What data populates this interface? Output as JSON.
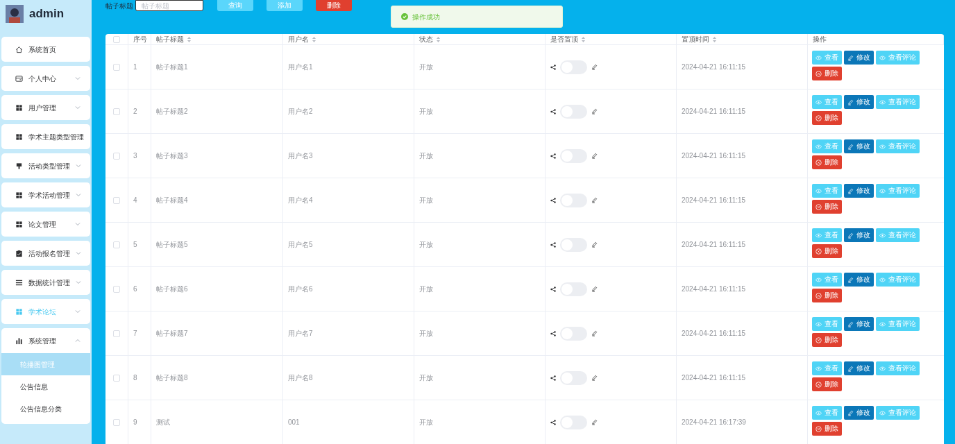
{
  "sidebar": {
    "user": "admin",
    "items": [
      {
        "label": "系统首页",
        "kind": "home",
        "expandable": false,
        "expanded": false,
        "selected": false
      },
      {
        "label": "个人中心",
        "kind": "card",
        "expandable": true,
        "expanded": false,
        "selected": false
      },
      {
        "label": "用户管理",
        "kind": "grid",
        "expandable": true,
        "expanded": false,
        "selected": false
      },
      {
        "label": "学术主题类型管理",
        "kind": "grid",
        "expandable": false,
        "expanded": false,
        "selected": false
      },
      {
        "label": "活动类型管理",
        "kind": "flag",
        "expandable": true,
        "expanded": false,
        "selected": false
      },
      {
        "label": "学术活动管理",
        "kind": "grid",
        "expandable": true,
        "expanded": false,
        "selected": false
      },
      {
        "label": "论文管理",
        "kind": "grid",
        "expandable": true,
        "expanded": false,
        "selected": false
      },
      {
        "label": "活动报名管理",
        "kind": "clipboard",
        "expandable": true,
        "expanded": false,
        "selected": false
      },
      {
        "label": "数据统计管理",
        "kind": "list",
        "expandable": true,
        "expanded": false,
        "selected": false
      },
      {
        "label": "学术论坛",
        "kind": "grid",
        "expandable": true,
        "expanded": false,
        "selected": true
      },
      {
        "label": "系统管理",
        "kind": "chart",
        "expandable": true,
        "expanded": true,
        "selected": false,
        "children": [
          {
            "label": "轮播图管理",
            "selected": true
          },
          {
            "label": "公告信息",
            "selected": false
          },
          {
            "label": "公告信息分类",
            "selected": false
          }
        ]
      }
    ]
  },
  "toolbar": {
    "label": "帖子标题",
    "search": {
      "placeholder": "帖子标题"
    },
    "buttons": [
      {
        "label": "查询",
        "kind": "light"
      },
      {
        "label": "添加",
        "kind": "light"
      },
      {
        "label": "删除",
        "kind": "danger"
      }
    ]
  },
  "toast": {
    "message": "操作成功"
  },
  "table": {
    "columns": [
      {
        "label": "序号"
      },
      {
        "label": "帖子标题",
        "sortable": true
      },
      {
        "label": "用户名",
        "sortable": true
      },
      {
        "label": "状态",
        "sortable": true
      },
      {
        "label": "是否置顶",
        "sortable": true
      },
      {
        "label": "置顶时间",
        "sortable": true
      },
      {
        "label": "操作",
        "sortable": false
      }
    ],
    "header_checked": false,
    "rows": [
      {
        "checked": false,
        "index": "1",
        "title": "帖子标题1",
        "user": "用户名1",
        "status": "开放",
        "pinned": false,
        "time": "2024-04-21 16:11:15",
        "actions": [
          {
            "label": "查看",
            "kind": "view"
          },
          {
            "label": "修改",
            "kind": "edit"
          },
          {
            "label": "查看评论",
            "kind": "view"
          },
          {
            "label": "删除",
            "kind": "delete"
          }
        ]
      },
      {
        "checked": false,
        "index": "2",
        "title": "帖子标题2",
        "user": "用户名2",
        "status": "开放",
        "pinned": false,
        "time": "2024-04-21 16:11:15",
        "actions": [
          {
            "label": "查看",
            "kind": "view"
          },
          {
            "label": "修改",
            "kind": "edit"
          },
          {
            "label": "查看评论",
            "kind": "view"
          },
          {
            "label": "删除",
            "kind": "delete"
          }
        ]
      },
      {
        "checked": false,
        "index": "3",
        "title": "帖子标题3",
        "user": "用户名3",
        "status": "开放",
        "pinned": false,
        "time": "2024-04-21 16:11:15",
        "actions": [
          {
            "label": "查看",
            "kind": "view"
          },
          {
            "label": "修改",
            "kind": "edit"
          },
          {
            "label": "查看评论",
            "kind": "view"
          },
          {
            "label": "删除",
            "kind": "delete"
          }
        ]
      },
      {
        "checked": false,
        "index": "4",
        "title": "帖子标题4",
        "user": "用户名4",
        "status": "开放",
        "pinned": false,
        "time": "2024-04-21 16:11:15",
        "actions": [
          {
            "label": "查看",
            "kind": "view"
          },
          {
            "label": "修改",
            "kind": "edit"
          },
          {
            "label": "查看评论",
            "kind": "view"
          },
          {
            "label": "删除",
            "kind": "delete"
          }
        ]
      },
      {
        "checked": false,
        "index": "5",
        "title": "帖子标题5",
        "user": "用户名5",
        "status": "开放",
        "pinned": false,
        "time": "2024-04-21 16:11:15",
        "actions": [
          {
            "label": "查看",
            "kind": "view"
          },
          {
            "label": "修改",
            "kind": "edit"
          },
          {
            "label": "查看评论",
            "kind": "view"
          },
          {
            "label": "删除",
            "kind": "delete"
          }
        ]
      },
      {
        "checked": false,
        "index": "6",
        "title": "帖子标题6",
        "user": "用户名6",
        "status": "开放",
        "pinned": false,
        "time": "2024-04-21 16:11:15",
        "actions": [
          {
            "label": "查看",
            "kind": "view"
          },
          {
            "label": "修改",
            "kind": "edit"
          },
          {
            "label": "查看评论",
            "kind": "view"
          },
          {
            "label": "删除",
            "kind": "delete"
          }
        ]
      },
      {
        "checked": false,
        "index": "7",
        "title": "帖子标题7",
        "user": "用户名7",
        "status": "开放",
        "pinned": false,
        "time": "2024-04-21 16:11:15",
        "actions": [
          {
            "label": "查看",
            "kind": "view"
          },
          {
            "label": "修改",
            "kind": "edit"
          },
          {
            "label": "查看评论",
            "kind": "view"
          },
          {
            "label": "删除",
            "kind": "delete"
          }
        ]
      },
      {
        "checked": false,
        "index": "8",
        "title": "帖子标题8",
        "user": "用户名8",
        "status": "开放",
        "pinned": false,
        "time": "2024-04-21 16:11:15",
        "actions": [
          {
            "label": "查看",
            "kind": "view"
          },
          {
            "label": "修改",
            "kind": "edit"
          },
          {
            "label": "查看评论",
            "kind": "view"
          },
          {
            "label": "删除",
            "kind": "delete"
          }
        ]
      },
      {
        "checked": false,
        "index": "9",
        "title": "测试",
        "user": "001",
        "status": "开放",
        "pinned": false,
        "time": "2024-04-21 16:17:39",
        "actions": [
          {
            "label": "查看",
            "kind": "view"
          },
          {
            "label": "修改",
            "kind": "edit"
          },
          {
            "label": "查看评论",
            "kind": "view"
          },
          {
            "label": "删除",
            "kind": "delete"
          }
        ]
      }
    ]
  }
}
